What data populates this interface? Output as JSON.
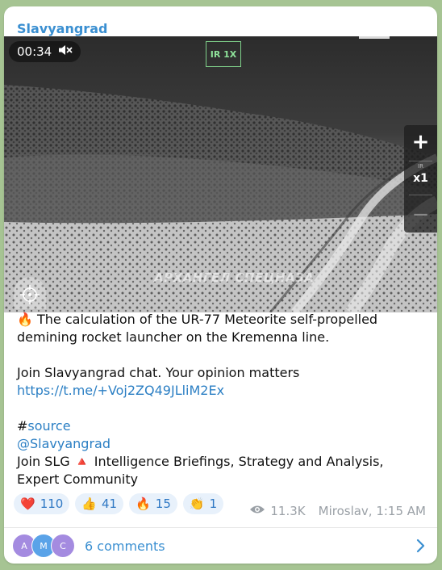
{
  "channel": {
    "name": "Slavyangrad"
  },
  "video": {
    "duration": "00:34",
    "ir_mode": "IR 1X",
    "zoom_plus": "+",
    "zoom_ir_label": "IR",
    "zoom_level": "x1",
    "zoom_minus": "−",
    "watermark": "АРХАНГЕЛ СПЕЦНАЗА"
  },
  "post": {
    "line1_emoji": "🔥",
    "line1": "The calculation of the UR-77 Meteorite self-propelled demining rocket launcher on the Kremenna line.",
    "line2": "Join Slavyangrad chat. Your opinion matters",
    "link": "https://t.me/+Voj2ZQ49JLliM2Ex",
    "hashtag_prefix": "#",
    "hashtag": "source",
    "mention": "@Slavyangrad",
    "footer_pre": "Join SLG",
    "footer_emoji": "🔺",
    "footer_post": "Intelligence Briefings, Strategy and Analysis, Expert Community"
  },
  "reactions": [
    {
      "emoji": "❤️",
      "count": "110"
    },
    {
      "emoji": "👍",
      "count": "41"
    },
    {
      "emoji": "🔥",
      "count": "15"
    },
    {
      "emoji": "👏",
      "count": "1"
    }
  ],
  "meta": {
    "views": "11.3K",
    "author_time": "Miroslav, 1:15 AM"
  },
  "comments": {
    "avatars": [
      "A",
      "M",
      "C"
    ],
    "avatar_colors": [
      "#a48be0",
      "#5aa3e8",
      "#a48be0"
    ],
    "label": "6 comments"
  }
}
